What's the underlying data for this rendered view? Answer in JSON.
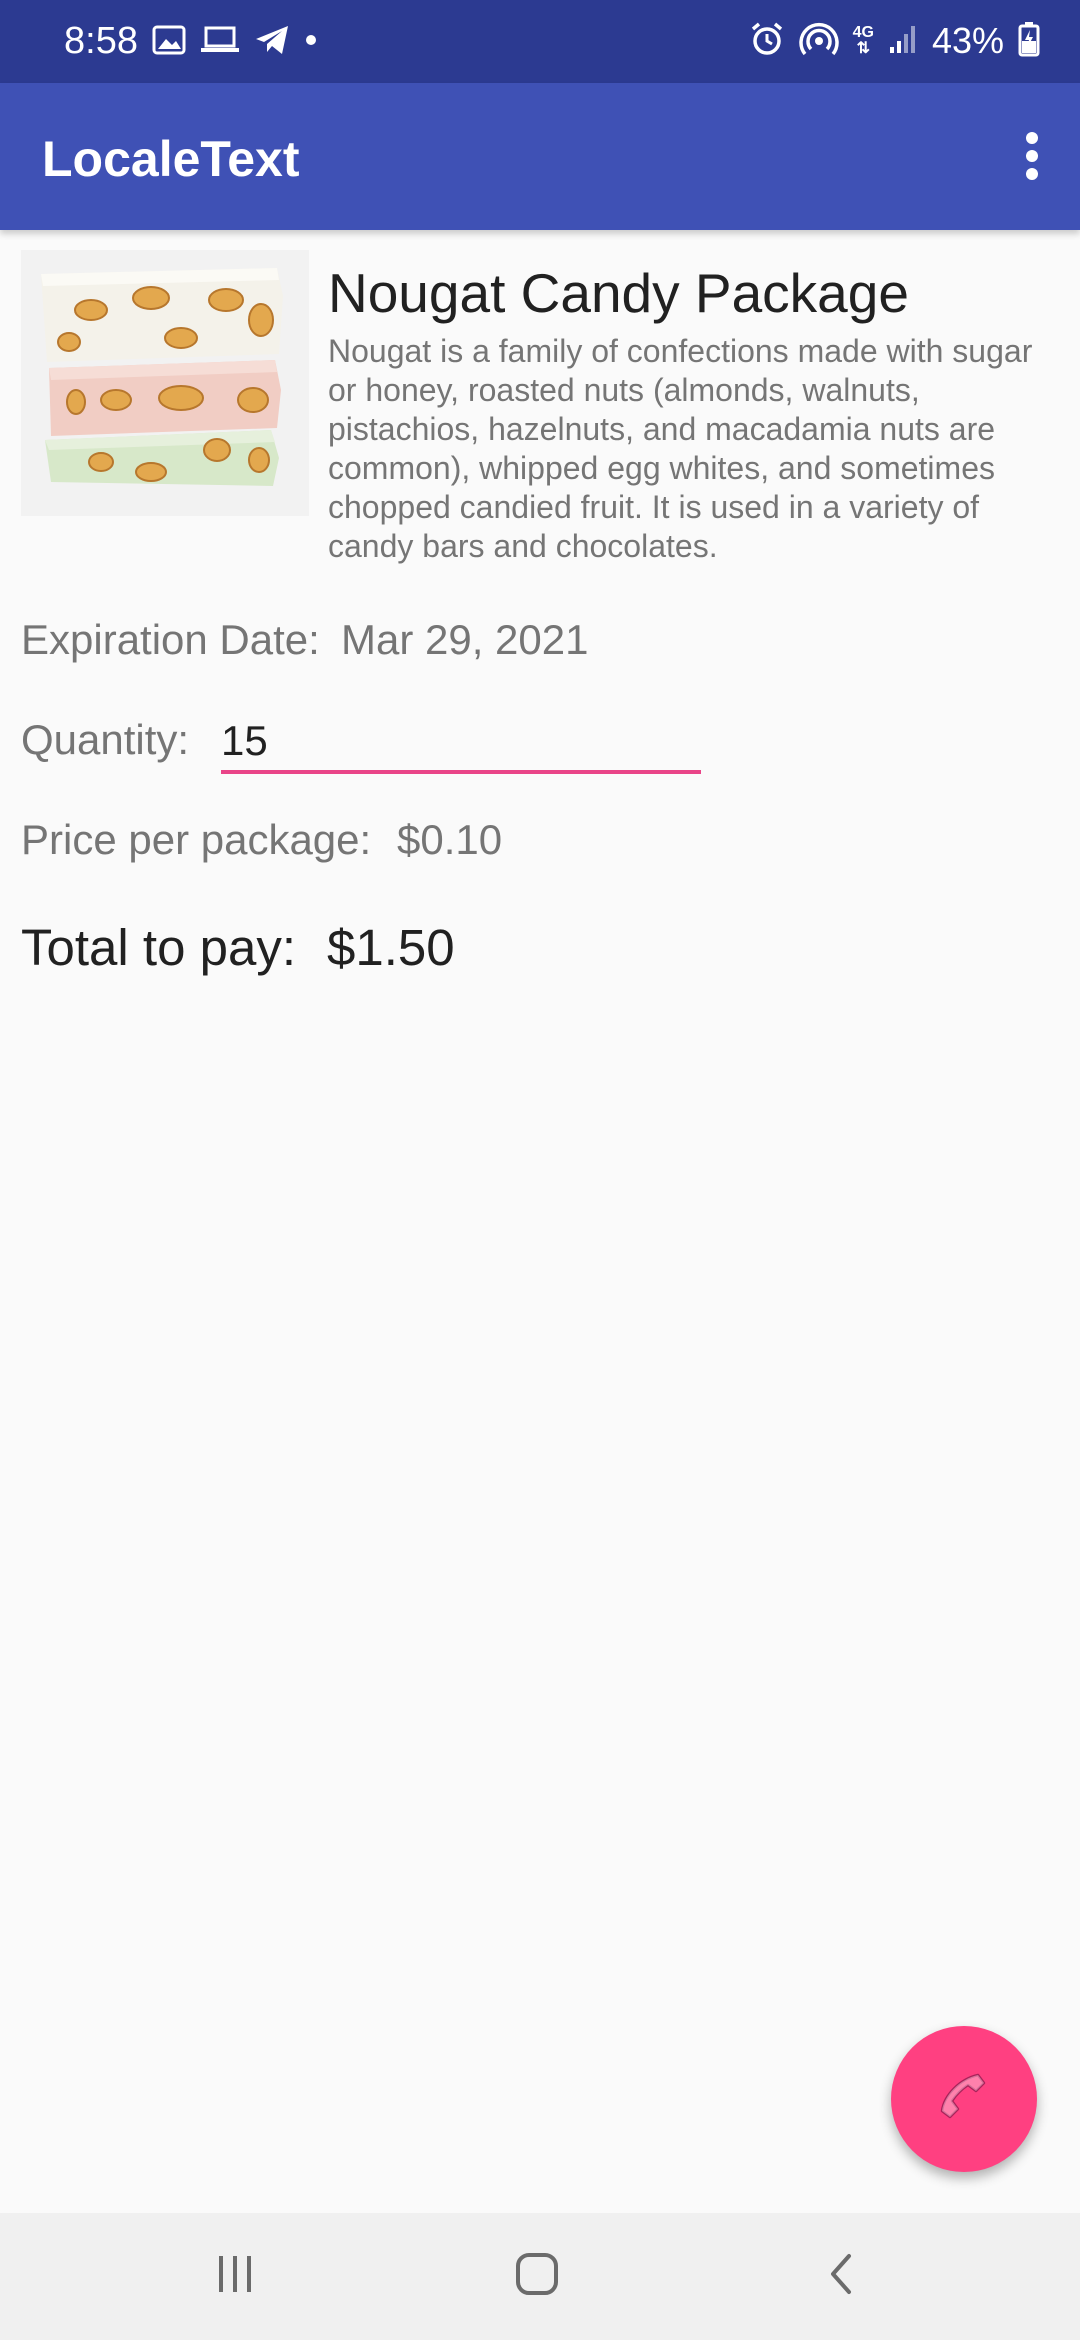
{
  "status_bar": {
    "time": "8:58",
    "battery": "43%",
    "network": "4G"
  },
  "app_bar": {
    "title": "LocaleText",
    "menu_icon": "more-vert-icon"
  },
  "product": {
    "title": "Nougat Candy Package",
    "description": "Nougat is a family of confections made with sugar or honey, roasted nuts (almonds, walnuts, pistachios, hazelnuts, and macadamia nuts are common), whipped egg whites, and sometimes chopped candied fruit. It is used in a variety of candy bars and chocolates."
  },
  "details": {
    "expiration_label": "Expiration Date:",
    "expiration_value": "Mar 29, 2021",
    "quantity_label": "Quantity:",
    "quantity_value": "15",
    "price_label": "Price per package:",
    "price_value": "$0.10",
    "total_label": "Total to pay:",
    "total_value": "$1.50"
  },
  "fab": {
    "icon": "phone-icon"
  },
  "nav_bar": {
    "recents_icon": "recents-icon",
    "home_icon": "home-icon",
    "back_icon": "back-icon"
  },
  "colors": {
    "status_bar": "#2c3a91",
    "app_bar": "#3f51b5",
    "accent": "#ff4081",
    "input_underline": "#e94488",
    "background": "#fafafa"
  }
}
